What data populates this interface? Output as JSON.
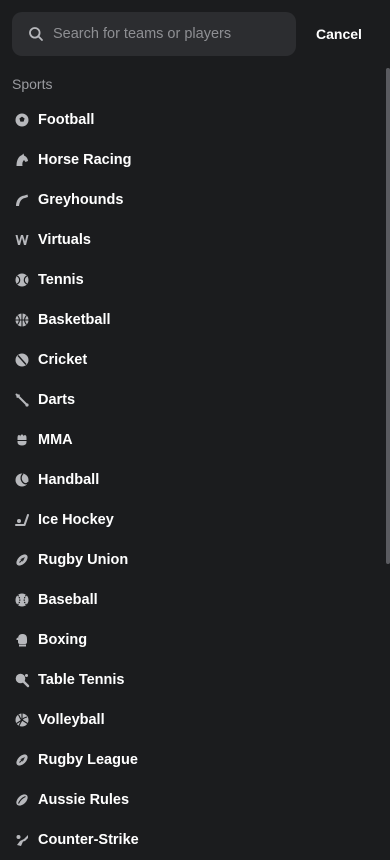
{
  "search": {
    "placeholder": "Search for teams or players",
    "cancel_label": "Cancel"
  },
  "section": {
    "title": "Sports"
  },
  "sports": [
    {
      "label": "Football",
      "icon": "football-icon"
    },
    {
      "label": "Horse Racing",
      "icon": "horse-racing-icon"
    },
    {
      "label": "Greyhounds",
      "icon": "greyhound-icon"
    },
    {
      "label": "Virtuals",
      "icon": "virtuals-icon"
    },
    {
      "label": "Tennis",
      "icon": "tennis-icon"
    },
    {
      "label": "Basketball",
      "icon": "basketball-icon"
    },
    {
      "label": "Cricket",
      "icon": "cricket-icon"
    },
    {
      "label": "Darts",
      "icon": "darts-icon"
    },
    {
      "label": "MMA",
      "icon": "mma-icon"
    },
    {
      "label": "Handball",
      "icon": "handball-icon"
    },
    {
      "label": "Ice Hockey",
      "icon": "ice-hockey-icon"
    },
    {
      "label": "Rugby Union",
      "icon": "rugby-union-icon"
    },
    {
      "label": "Baseball",
      "icon": "baseball-icon"
    },
    {
      "label": "Boxing",
      "icon": "boxing-icon"
    },
    {
      "label": "Table Tennis",
      "icon": "table-tennis-icon"
    },
    {
      "label": "Volleyball",
      "icon": "volleyball-icon"
    },
    {
      "label": "Rugby League",
      "icon": "rugby-league-icon"
    },
    {
      "label": "Aussie Rules",
      "icon": "aussie-rules-icon"
    },
    {
      "label": "Counter-Strike",
      "icon": "counter-strike-icon"
    }
  ],
  "colors": {
    "background": "#1b1c1e",
    "search_bg": "#2c2d30",
    "icon": "#b7b8bc",
    "muted_text": "#9a9ba0"
  }
}
